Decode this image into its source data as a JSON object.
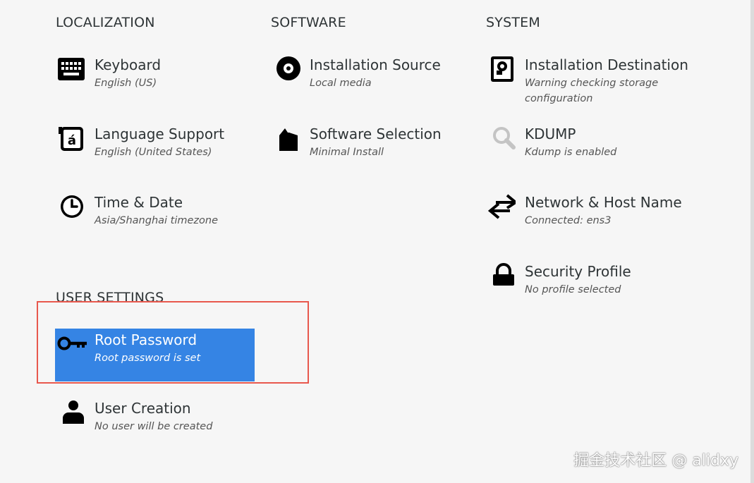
{
  "sections": {
    "localization": "LOCALIZATION",
    "software": "SOFTWARE",
    "system": "SYSTEM",
    "user_settings": "USER SETTINGS"
  },
  "spokes": {
    "keyboard": {
      "label": "Keyboard",
      "status": "English (US)",
      "icon": "keyboard-icon"
    },
    "language": {
      "label": "Language Support",
      "status": "English (United States)",
      "icon": "language-icon"
    },
    "time": {
      "label": "Time & Date",
      "status": "Asia/Shanghai timezone",
      "icon": "clock-icon"
    },
    "source": {
      "label": "Installation Source",
      "status": "Local media",
      "icon": "disc-icon"
    },
    "software": {
      "label": "Software Selection",
      "status": "Minimal Install",
      "icon": "package-icon"
    },
    "destination": {
      "label": "Installation Destination",
      "status": "Warning checking storage configuration",
      "icon": "disk-icon"
    },
    "kdump": {
      "label": "KDUMP",
      "status": "Kdump is enabled",
      "icon": "magnifier-icon"
    },
    "network": {
      "label": "Network & Host Name",
      "status": "Connected: ens3",
      "icon": "network-arrows-icon"
    },
    "security": {
      "label": "Security Profile",
      "status": "No profile selected",
      "icon": "lock-icon"
    },
    "root": {
      "label": "Root Password",
      "status": "Root password is set",
      "icon": "key-icon"
    },
    "user": {
      "label": "User Creation",
      "status": "No user will be created",
      "icon": "user-icon"
    }
  },
  "colors": {
    "selected": "#3584e4",
    "highlight_border": "#e8584d",
    "background": "#f6f6f6"
  },
  "watermark": "掘金技术社区 @ alidxy"
}
